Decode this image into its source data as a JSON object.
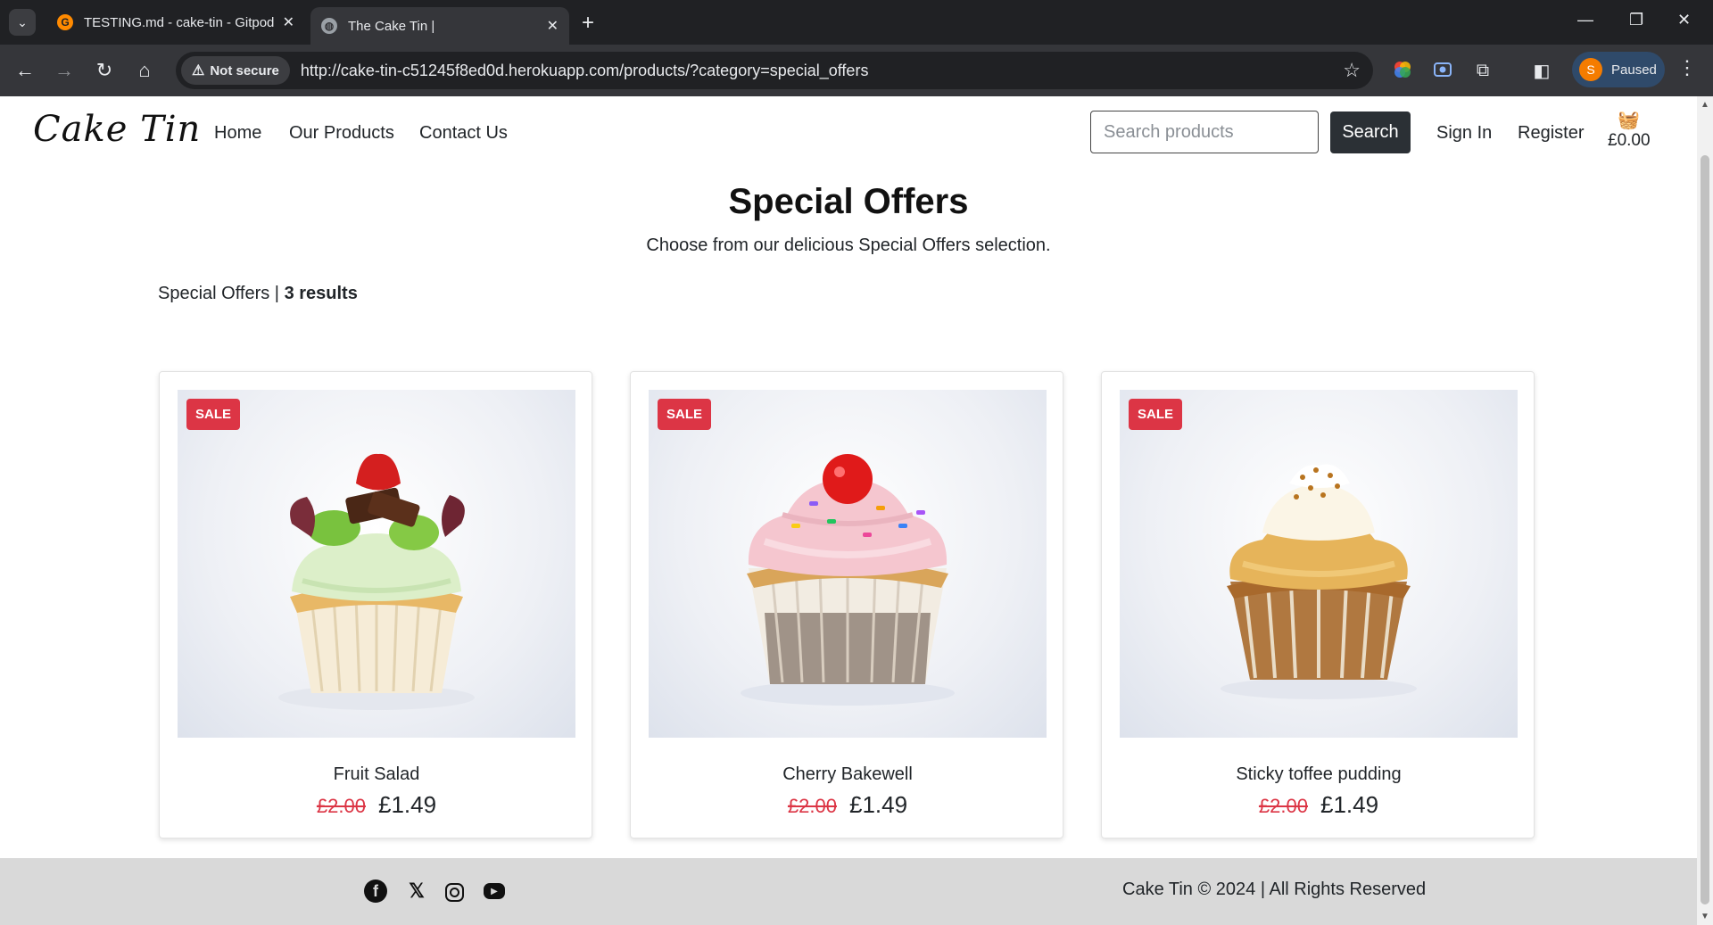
{
  "browser": {
    "tabs": [
      {
        "title": "TESTING.md - cake-tin - Gitpod",
        "favicon": "gitpod-icon"
      },
      {
        "title": "The Cake Tin |",
        "favicon": "globe-icon"
      }
    ],
    "security_label": "Not secure",
    "url": "http://cake-tin-c51245f8ed0d.herokuapp.com/products/?category=special_offers",
    "profile": {
      "initial": "S",
      "status": "Paused"
    }
  },
  "site": {
    "logo": "Cake Tin",
    "nav": [
      "Home",
      "Our Products",
      "Contact Us"
    ],
    "search": {
      "placeholder": "Search products",
      "button": "Search"
    },
    "account": {
      "sign_in": "Sign In",
      "register": "Register"
    },
    "basket_total": "£0.00"
  },
  "page": {
    "title": "Special Offers",
    "subtitle": "Choose from our delicious Special Offers selection.",
    "category": "Special Offers |",
    "results": "3 results"
  },
  "products": [
    {
      "name": "Fruit Salad",
      "old_price": "£2.00",
      "price": "£1.49",
      "badge": "SALE"
    },
    {
      "name": "Cherry Bakewell",
      "old_price": "£2.00",
      "price": "£1.49",
      "badge": "SALE"
    },
    {
      "name": "Sticky toffee pudding",
      "old_price": "£2.00",
      "price": "£1.49",
      "badge": "SALE"
    }
  ],
  "footer": {
    "social": [
      "facebook-icon",
      "x-icon",
      "instagram-icon",
      "youtube-icon"
    ],
    "copyright": "Cake Tin © 2024 | All Rights Reserved"
  },
  "colors": {
    "sale": "#dc3545",
    "dark_button": "#2b3035",
    "footer_bg": "#d9d9d9"
  }
}
